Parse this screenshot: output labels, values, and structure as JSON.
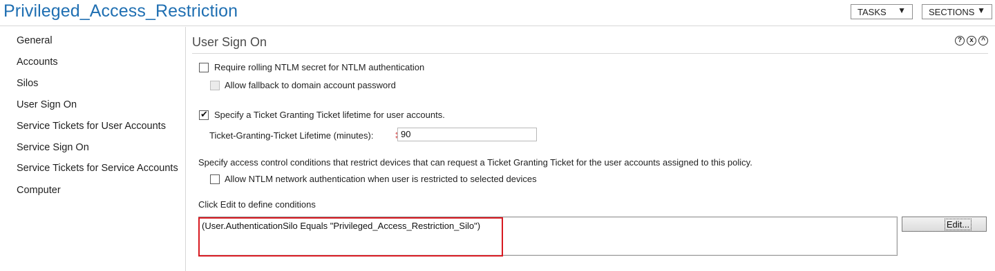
{
  "header": {
    "title": "Privileged_Access_Restriction",
    "tasks_label": "TASKS",
    "sections_label": "SECTIONS",
    "dropdown_glyph": "▼"
  },
  "sidebar": {
    "items": [
      {
        "label": "General"
      },
      {
        "label": "Accounts"
      },
      {
        "label": "Silos"
      },
      {
        "label": "User Sign On"
      },
      {
        "label": "Service Tickets for User Accounts"
      },
      {
        "label": "Service Sign On"
      },
      {
        "label": "Service Tickets for Service Accounts"
      },
      {
        "label": "Computer"
      }
    ]
  },
  "section": {
    "title": "User Sign On",
    "icons": {
      "help": "?",
      "close": "x",
      "collapse": "^"
    },
    "ntlm_rolling_label": "Require rolling NTLM secret for NTLM authentication",
    "ntlm_rolling_checked": false,
    "fallback_label": "Allow fallback to domain account password",
    "fallback_enabled": false,
    "tgt_label": "Specify a Ticket Granting Ticket lifetime for user accounts.",
    "tgt_checked": true,
    "tgt_lifetime_label": "Ticket-Granting-Ticket Lifetime (minutes):",
    "tgt_lifetime_value": "90",
    "required_marker": "✱",
    "access_control_text": "Specify access control conditions that restrict devices that can request a Ticket Granting Ticket for the user accounts assigned to this policy.",
    "allow_ntlm_label": "Allow NTLM network authentication when user is restricted to selected devices",
    "allow_ntlm_checked": false,
    "click_edit_text": "Click Edit to define conditions",
    "conditions_value": "(User.AuthenticationSilo Equals \"Privileged_Access_Restriction_Silo\")",
    "edit_label": "Edit..."
  },
  "colors": {
    "title_blue": "#1f6fb2",
    "highlight_red": "#d71920",
    "required_star": "#e27a7a"
  }
}
